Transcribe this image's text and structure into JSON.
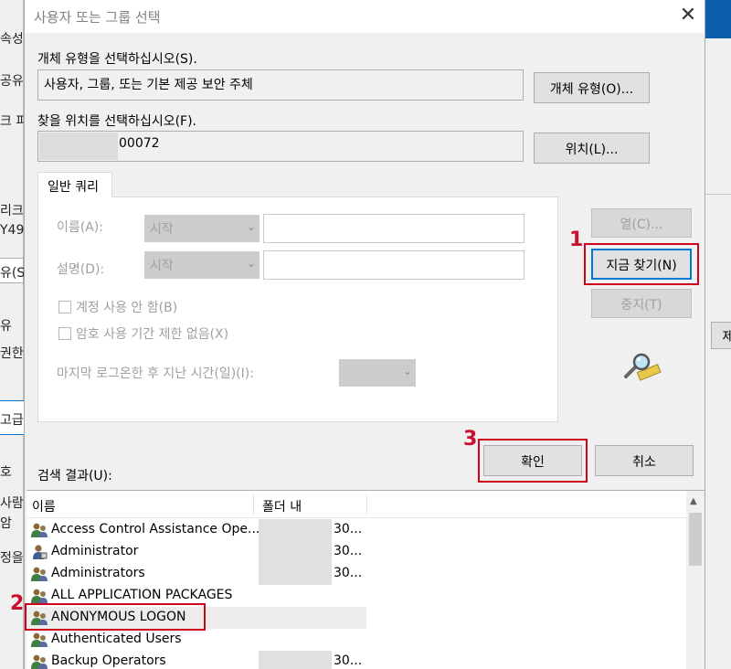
{
  "background": {
    "left_texts": [
      "속성",
      "공유",
      "크 피",
      "리크",
      "Y49",
      "유(S",
      "유",
      "권한",
      "고급",
      "호",
      "사람",
      "암",
      "정을"
    ],
    "right_button_text": "제"
  },
  "dialog": {
    "title": "사용자 또는 그룹 선택",
    "close_icon": "✕",
    "object_type_label": "개체 유형을 선택하십시오(S).",
    "object_type_value": "사용자, 그룹, 또는 기본 제공 보안 주체",
    "object_type_button": "개체 유형(O)...",
    "location_label": "찾을 위치를 선택하십시오(F).",
    "location_value": "00072",
    "location_button": "위치(L)...",
    "tab_label": "일반 쿼리",
    "name_label": "이름(A):",
    "name_combo": "시작",
    "desc_label": "설명(D):",
    "desc_combo": "시작",
    "chk_disabled_label": "계정 사용 안 함(B)",
    "chk_noexpire_label": "암호 사용 기간 제한 없음(X)",
    "days_label": "마지막 로그온한 후 지난 시간(일)(I):",
    "columns_button": "열(C)...",
    "find_now_button": "지금 찾기(N)",
    "stop_button": "중지(T)",
    "ok_button": "확인",
    "cancel_button": "취소",
    "results_label": "검색 결과(U):"
  },
  "annotations": {
    "step1": "1",
    "step2": "2",
    "step3": "3"
  },
  "results": {
    "col_name": "이름",
    "col_folder": "폴더 내",
    "rows": [
      {
        "name": "Access Control Assistance Ope...",
        "folder": "30..."
      },
      {
        "name": "Administrator",
        "folder": "30..."
      },
      {
        "name": "Administrators",
        "folder": "30..."
      },
      {
        "name": "ALL APPLICATION PACKAGES",
        "folder": ""
      },
      {
        "name": "ANONYMOUS LOGON",
        "folder": ""
      },
      {
        "name": "Authenticated Users",
        "folder": ""
      },
      {
        "name": "Backup Operators",
        "folder": "30..."
      }
    ]
  },
  "colors": {
    "annotation_red": "#d0021b",
    "focus_blue": "#0078d7"
  }
}
